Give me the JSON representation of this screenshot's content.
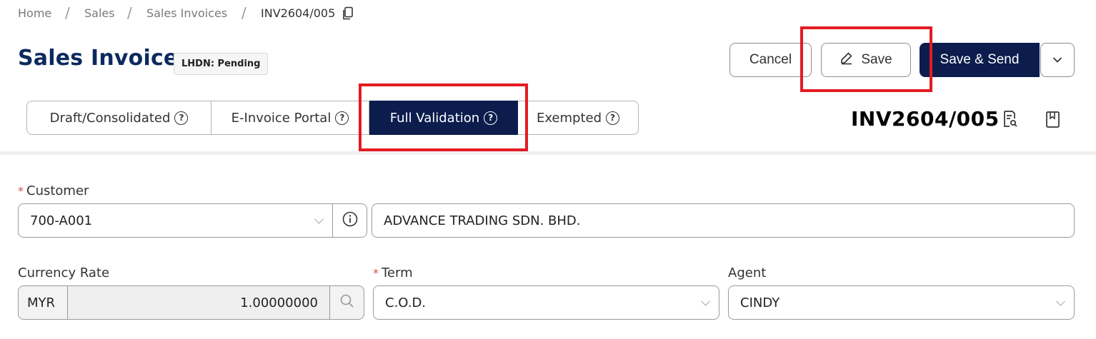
{
  "breadcrumb": {
    "items": [
      "Home",
      "Sales",
      "Sales Invoices"
    ],
    "current": "INV2604/005",
    "separator": "/"
  },
  "header": {
    "title": "Sales Invoice",
    "badge": "LHDN: Pending",
    "cancel_label": "Cancel",
    "save_label": "Save",
    "save_send_label": "Save & Send"
  },
  "tabs": [
    {
      "label": "Draft/Consolidated",
      "active": false
    },
    {
      "label": "E-Invoice Portal",
      "active": false
    },
    {
      "label": "Full Validation",
      "active": true
    },
    {
      "label": "Exempted",
      "active": false
    }
  ],
  "document": {
    "number": "INV2604/005"
  },
  "form": {
    "customer": {
      "label": "Customer",
      "code": "700-A001",
      "name": "ADVANCE TRADING SDN. BHD."
    },
    "currency_rate": {
      "label": "Currency Rate",
      "currency": "MYR",
      "rate": "1.00000000"
    },
    "term": {
      "label": "Term",
      "value": "C.O.D."
    },
    "agent": {
      "label": "Agent",
      "value": "CINDY"
    },
    "required_marker": "*"
  },
  "colors": {
    "brand_navy": "#0b1c4d",
    "title_navy": "#0d2a5e",
    "highlight_red": "#e31b23",
    "required_red": "#e04a4a"
  }
}
